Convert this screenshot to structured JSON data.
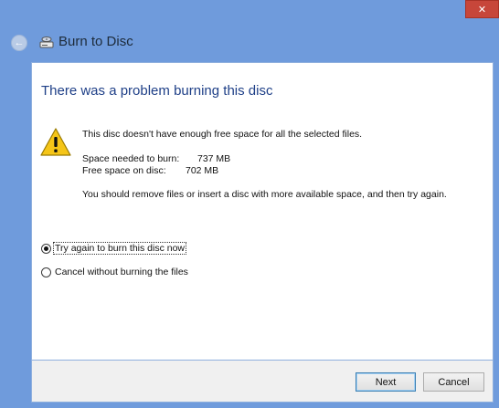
{
  "window": {
    "title": "Burn to Disc",
    "close_glyph": "✕",
    "back_glyph": "←",
    "accent": "#1e3f87",
    "close_color": "#c7463a"
  },
  "dialog": {
    "heading": "There was a problem burning this disc",
    "message": "This disc doesn't have enough free space for all the selected files.",
    "space_needed_label": "Space needed to burn:",
    "space_needed_value": "737 MB",
    "free_space_label": "Free space on disc:",
    "free_space_value": "702 MB",
    "advice": "You should remove files or insert a disc with more available space, and then try again."
  },
  "options": [
    {
      "label": "Try again to burn this disc now",
      "selected": true
    },
    {
      "label": "Cancel without burning the files",
      "selected": false
    }
  ],
  "buttons": {
    "next": "Next",
    "cancel": "Cancel"
  },
  "icons": {
    "warning": "warning-icon",
    "burn": "disc-burn-icon",
    "back": "back-arrow-icon",
    "close": "close-icon"
  }
}
